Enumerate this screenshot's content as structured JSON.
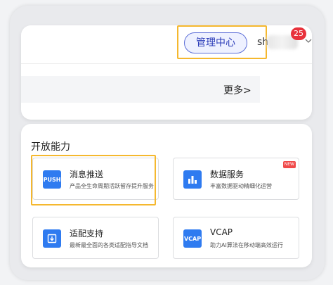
{
  "header": {
    "admin_button": "管理中心",
    "user_name": "sh",
    "notification_count": "25"
  },
  "banner": {
    "more_link": "更多>"
  },
  "capabilities": {
    "title": "开放能力",
    "tiles": [
      {
        "title": "消息推送",
        "desc": "产品全生命周期活跃留存提升服务",
        "icon": "push-icon",
        "icon_label": "PUSH",
        "badge": ""
      },
      {
        "title": "数据服务",
        "desc": "丰富数据驱动精细化运营",
        "icon": "bar-chart-icon",
        "icon_label": "",
        "badge": "NEW"
      },
      {
        "title": "适配支持",
        "desc": "最新最全面的各类适配指导文档",
        "icon": "download-box-icon",
        "icon_label": "",
        "badge": ""
      },
      {
        "title": "VCAP",
        "desc": "助力AI算法在移动端高效运行",
        "icon": "vcap-icon",
        "icon_label": "VCAP",
        "badge": ""
      }
    ]
  },
  "colors": {
    "accent": "#2f7bf0",
    "highlight": "#f5b82e",
    "badge_red": "#e8323c"
  }
}
